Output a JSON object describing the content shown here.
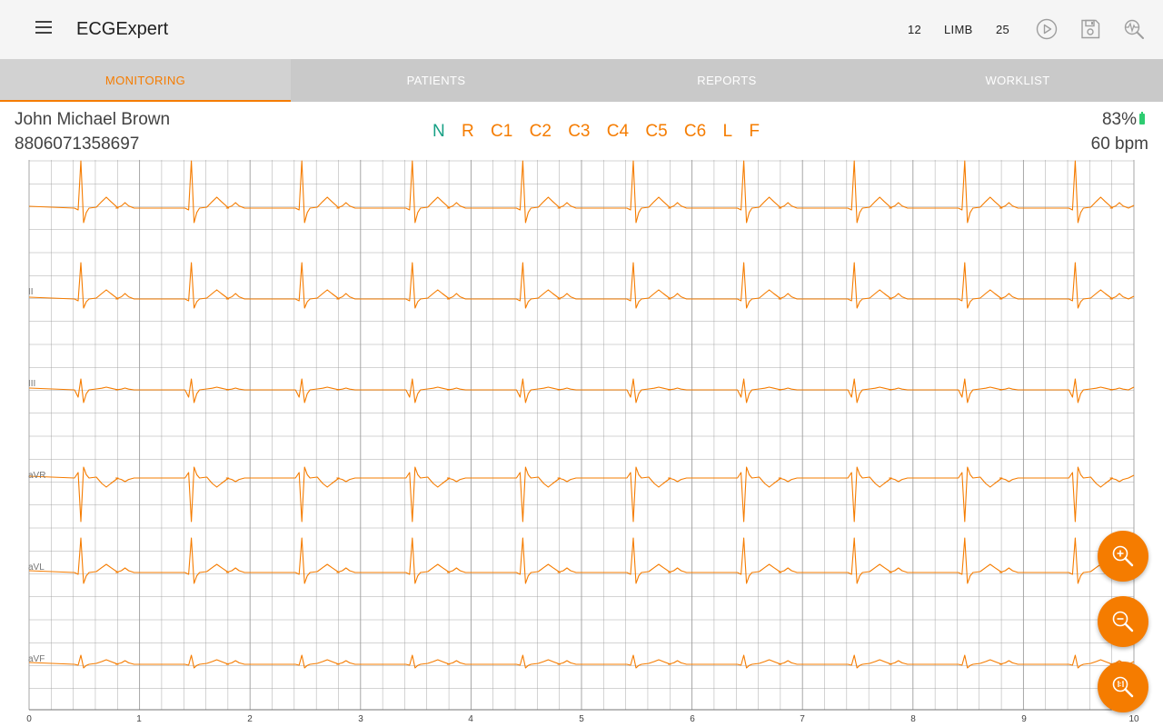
{
  "appbar": {
    "title": "ECGExpert",
    "lead_count": "12",
    "lead_mode": "LIMB",
    "speed": "25",
    "icons": [
      "menu-icon",
      "play-icon",
      "save-icon",
      "ecg-search-icon"
    ]
  },
  "tabs": [
    {
      "label": "MONITORING",
      "active": true
    },
    {
      "label": "PATIENTS",
      "active": false
    },
    {
      "label": "REPORTS",
      "active": false
    },
    {
      "label": "WORKLIST",
      "active": false
    }
  ],
  "patient": {
    "name": "John Michael Brown",
    "id": "8806071358697"
  },
  "electrodes": [
    {
      "label": "N",
      "status": "ok"
    },
    {
      "label": "R",
      "status": "warn"
    },
    {
      "label": "C1",
      "status": "warn"
    },
    {
      "label": "C2",
      "status": "warn"
    },
    {
      "label": "C3",
      "status": "warn"
    },
    {
      "label": "C4",
      "status": "warn"
    },
    {
      "label": "C5",
      "status": "warn"
    },
    {
      "label": "C6",
      "status": "warn"
    },
    {
      "label": "L",
      "status": "warn"
    },
    {
      "label": "F",
      "status": "warn"
    }
  ],
  "status": {
    "battery": "83%",
    "heart_rate": "60 bpm"
  },
  "ecg": {
    "leads": [
      "",
      "II",
      "III",
      "aVR",
      "aVL",
      "aVF"
    ],
    "x_ticks": [
      "0",
      "1",
      "2",
      "3",
      "4",
      "5",
      "6",
      "7",
      "8",
      "9",
      "10"
    ],
    "beats_per_strip": 10
  },
  "fabs": [
    {
      "name": "zoom-in-button",
      "icon": "zoom-in-icon"
    },
    {
      "name": "zoom-out-button",
      "icon": "zoom-out-icon"
    },
    {
      "name": "zoom-reset-button",
      "icon": "zoom-actual-icon"
    }
  ],
  "colors": {
    "accent": "#f57c00",
    "trace": "#f57c00",
    "ok": "#16a085",
    "battery": "#2ecc71",
    "grid": "#9e9e9e"
  }
}
